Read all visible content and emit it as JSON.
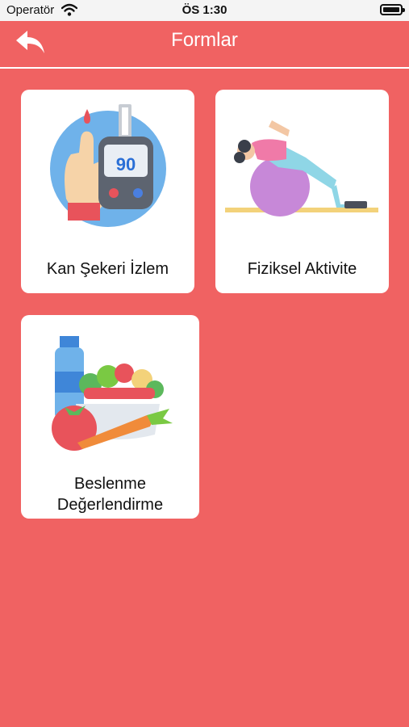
{
  "status_bar": {
    "carrier": "Operatör",
    "time": "ÖS 1:30"
  },
  "header": {
    "title": "Formlar",
    "back_icon": "reply-arrow-icon"
  },
  "colors": {
    "accent": "#f06262",
    "card": "#ffffff",
    "text": "#111111"
  },
  "cards": [
    {
      "label": "Kan Şekeri İzlem",
      "icon": "glucose-meter-icon",
      "meter_reading": "90"
    },
    {
      "label": "Fiziksel Aktivite",
      "icon": "exercise-ball-icon"
    },
    {
      "label_line1": "Beslenme",
      "label_line2": "Değerlendirme",
      "icon": "nutrition-icon"
    }
  ]
}
